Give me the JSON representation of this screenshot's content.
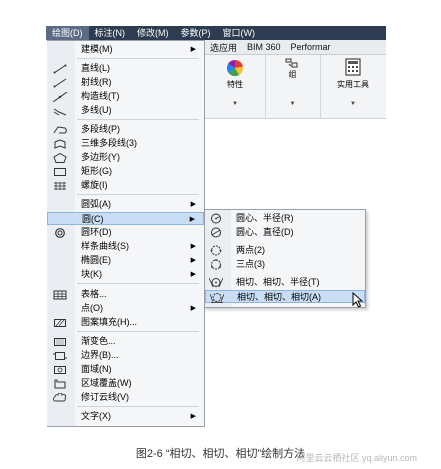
{
  "menubar": {
    "items": [
      {
        "label": "绘图(D)"
      },
      {
        "label": "标注(N)"
      },
      {
        "label": "修改(M)"
      },
      {
        "label": "参数(P)"
      },
      {
        "label": "窗口(W)"
      }
    ]
  },
  "ribbon": {
    "tabs": [
      "选应用",
      "BIM 360",
      "Performar"
    ],
    "panels": [
      {
        "label": "特性",
        "icon": "color-wheel-icon"
      },
      {
        "label": "组",
        "icon": "group-icon"
      },
      {
        "label": "实用工具",
        "icon": "calculator-icon"
      }
    ]
  },
  "draw_menu": {
    "items": [
      {
        "label": "建模(M)",
        "icon": "",
        "submenu": true
      },
      {
        "label": "直线(L)",
        "icon": "line-icon"
      },
      {
        "label": "射线(R)",
        "icon": "ray-icon"
      },
      {
        "label": "构造线(T)",
        "icon": "xline-icon"
      },
      {
        "label": "多线(U)",
        "icon": "mline-icon"
      },
      {
        "label": "多段线(P)",
        "icon": "polyline-icon"
      },
      {
        "label": "三维多段线(3)",
        "icon": "3d-polyline-icon"
      },
      {
        "label": "多边形(Y)",
        "icon": "polygon-icon"
      },
      {
        "label": "矩形(G)",
        "icon": "rectangle-icon"
      },
      {
        "label": "螺旋(I)",
        "icon": "helix-icon"
      },
      {
        "label": "圆弧(A)",
        "icon": "",
        "submenu": true
      },
      {
        "label": "圆(C)",
        "icon": "",
        "submenu": true,
        "highlighted": true
      },
      {
        "label": "圆环(D)",
        "icon": "donut-icon"
      },
      {
        "label": "样条曲线(S)",
        "icon": "",
        "submenu": true
      },
      {
        "label": "椭圆(E)",
        "icon": "",
        "submenu": true
      },
      {
        "label": "块(K)",
        "icon": "",
        "submenu": true
      },
      {
        "label": "表格...",
        "icon": "table-icon"
      },
      {
        "label": "点(O)",
        "icon": "",
        "submenu": true
      },
      {
        "label": "图案填充(H)...",
        "icon": "hatch-icon"
      },
      {
        "label": "渐变色...",
        "icon": "gradient-icon"
      },
      {
        "label": "边界(B)...",
        "icon": "boundary-icon"
      },
      {
        "label": "面域(N)",
        "icon": "region-icon"
      },
      {
        "label": "区域覆盖(W)",
        "icon": "wipeout-icon"
      },
      {
        "label": "修订云线(V)",
        "icon": "revcloud-icon"
      },
      {
        "label": "文字(X)",
        "icon": "",
        "submenu": true
      }
    ]
  },
  "circle_submenu": {
    "items": [
      {
        "label": "圆心、半径(R)",
        "icon": "circle-center-radius-icon"
      },
      {
        "label": "圆心、直径(D)",
        "icon": "circle-center-diameter-icon"
      },
      {
        "label": "两点(2)",
        "icon": "circle-2point-icon"
      },
      {
        "label": "三点(3)",
        "icon": "circle-3point-icon"
      },
      {
        "label": "相切、相切、半径(T)",
        "icon": "circle-ttr-icon"
      },
      {
        "label": "相切、相切、相切(A)",
        "icon": "circle-ttt-icon",
        "highlighted": true
      }
    ]
  },
  "caption": "图2-6 “相切、相切、相切”绘制方法",
  "watermark": "阿里云云栖社区 yq.aliyun.com",
  "colors": {
    "menubar": "#2e3c52",
    "highlight": "#c9def5",
    "highlight_border": "#8fb4e0",
    "menu_bg": "#f5f6f8"
  }
}
